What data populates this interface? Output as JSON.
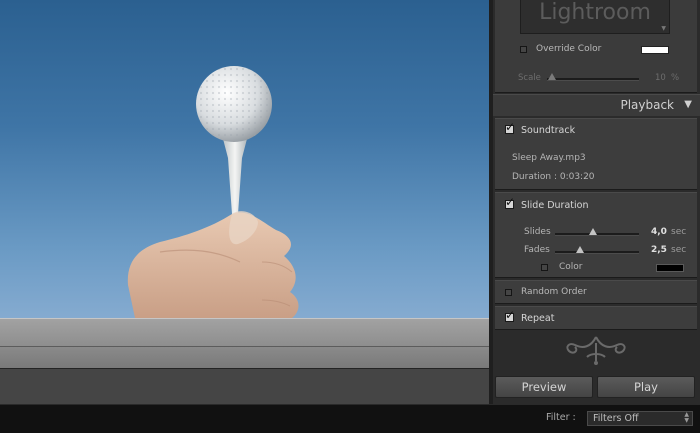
{
  "overlay": {
    "identity_plate_text": "Lightroom",
    "override_color_label": "Override Color",
    "scale_label": "Scale",
    "scale_value": "10",
    "scale_unit": "%",
    "override_color": "#ffffff"
  },
  "playback": {
    "header": "Playback",
    "soundtrack": {
      "label": "Soundtrack",
      "checked": true,
      "file": "Sleep Away.mp3",
      "duration": "Duration : 0:03:20"
    },
    "slide_duration": {
      "label": "Slide Duration",
      "checked": true,
      "slides_label": "Slides",
      "slides_value": "4,0",
      "slides_unit": "sec",
      "slides_fraction": 0.45,
      "fades_label": "Fades",
      "fades_value": "2,5",
      "fades_unit": "sec",
      "fades_fraction": 0.3,
      "color_label": "Color",
      "color": "#000000"
    },
    "random_order": {
      "label": "Random Order",
      "checked": false
    },
    "repeat": {
      "label": "Repeat",
      "checked": true
    }
  },
  "buttons": {
    "preview": "Preview",
    "play": "Play"
  },
  "filter": {
    "label": "Filter :",
    "value": "Filters Off"
  },
  "colors": {
    "accent_sky": "#3f75a6"
  }
}
